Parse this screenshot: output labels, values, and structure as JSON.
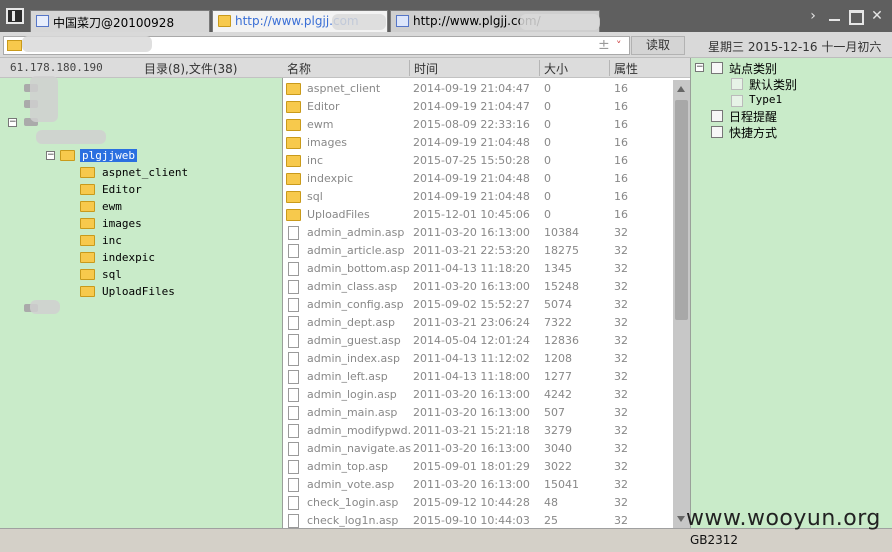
{
  "tabs": [
    {
      "label": "中国菜刀@20100928"
    },
    {
      "label": "http://www.plgjj.com"
    },
    {
      "label": "http://www.plgjj.com/"
    }
  ],
  "toolbar": {
    "plus": "±",
    "chevron": "˅",
    "read_label": "读取",
    "date": "星期三 2015-12-16 十一月初六"
  },
  "left": {
    "ip": "61.178.180.190",
    "summary": "目录(8),文件(38)",
    "selected_folder": "plgjjweb",
    "folders": [
      "aspnet_client",
      "Editor",
      "ewm",
      "images",
      "inc",
      "indexpic",
      "sql",
      "UploadFiles"
    ]
  },
  "filelist": {
    "columns": {
      "name": "名称",
      "time": "时间",
      "size": "大小",
      "attr": "属性"
    },
    "rows": [
      {
        "type": "folder",
        "name": "aspnet_client",
        "time": "2014-09-19 21:04:47",
        "size": "0",
        "attr": "16"
      },
      {
        "type": "folder",
        "name": "Editor",
        "time": "2014-09-19 21:04:47",
        "size": "0",
        "attr": "16"
      },
      {
        "type": "folder",
        "name": "ewm",
        "time": "2015-08-09 22:33:16",
        "size": "0",
        "attr": "16"
      },
      {
        "type": "folder",
        "name": "images",
        "time": "2014-09-19 21:04:48",
        "size": "0",
        "attr": "16"
      },
      {
        "type": "folder",
        "name": "inc",
        "time": "2015-07-25 15:50:28",
        "size": "0",
        "attr": "16"
      },
      {
        "type": "folder",
        "name": "indexpic",
        "time": "2014-09-19 21:04:48",
        "size": "0",
        "attr": "16"
      },
      {
        "type": "folder",
        "name": "sql",
        "time": "2014-09-19 21:04:48",
        "size": "0",
        "attr": "16"
      },
      {
        "type": "folder",
        "name": "UploadFiles",
        "time": "2015-12-01 10:45:06",
        "size": "0",
        "attr": "16"
      },
      {
        "type": "file",
        "name": "admin_admin.asp",
        "time": "2011-03-20 16:13:00",
        "size": "10384",
        "attr": "32"
      },
      {
        "type": "file",
        "name": "admin_article.asp",
        "time": "2011-03-21 22:53:20",
        "size": "18275",
        "attr": "32"
      },
      {
        "type": "file",
        "name": "admin_bottom.asp",
        "time": "2011-04-13 11:18:20",
        "size": "1345",
        "attr": "32"
      },
      {
        "type": "file",
        "name": "admin_class.asp",
        "time": "2011-03-20 16:13:00",
        "size": "15248",
        "attr": "32"
      },
      {
        "type": "file",
        "name": "admin_config.asp",
        "time": "2015-09-02 15:52:27",
        "size": "5074",
        "attr": "32"
      },
      {
        "type": "file",
        "name": "admin_dept.asp",
        "time": "2011-03-21 23:06:24",
        "size": "7322",
        "attr": "32"
      },
      {
        "type": "file",
        "name": "admin_guest.asp",
        "time": "2014-05-04 12:01:24",
        "size": "12836",
        "attr": "32"
      },
      {
        "type": "file",
        "name": "admin_index.asp",
        "time": "2011-04-13 11:12:02",
        "size": "1208",
        "attr": "32"
      },
      {
        "type": "file",
        "name": "admin_left.asp",
        "time": "2011-04-13 11:18:00",
        "size": "1277",
        "attr": "32"
      },
      {
        "type": "file",
        "name": "admin_login.asp",
        "time": "2011-03-20 16:13:00",
        "size": "4242",
        "attr": "32"
      },
      {
        "type": "file",
        "name": "admin_main.asp",
        "time": "2011-03-20 16:13:00",
        "size": "507",
        "attr": "32"
      },
      {
        "type": "file",
        "name": "admin_modifypwd.asp",
        "time": "2011-03-21 15:21:18",
        "size": "3279",
        "attr": "32"
      },
      {
        "type": "file",
        "name": "admin_navigate.asp",
        "time": "2011-03-20 16:13:00",
        "size": "3040",
        "attr": "32"
      },
      {
        "type": "file",
        "name": "admin_top.asp",
        "time": "2015-09-01 18:01:29",
        "size": "3022",
        "attr": "32"
      },
      {
        "type": "file",
        "name": "admin_vote.asp",
        "time": "2011-03-20 16:13:00",
        "size": "15041",
        "attr": "32"
      },
      {
        "type": "file",
        "name": "check_1ogin.asp",
        "time": "2015-09-12 10:44:28",
        "size": "48",
        "attr": "32"
      },
      {
        "type": "file",
        "name": "check_log1n.asp",
        "time": "2015-09-10 10:44:03",
        "size": "25",
        "attr": "32"
      }
    ]
  },
  "right": {
    "site_category": "站点类别",
    "default_category": "默认类别",
    "type1": "Type1",
    "schedule": "日程提醒",
    "shortcuts": "快捷方式"
  },
  "status": {
    "encoding": "GB2312"
  },
  "watermark": "www.wooyun.org"
}
